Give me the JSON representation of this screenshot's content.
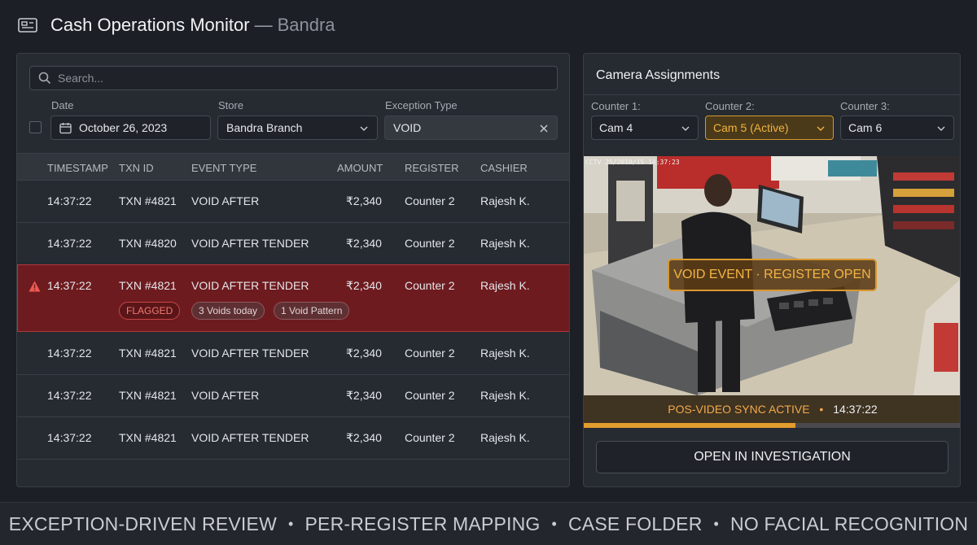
{
  "header": {
    "title": "Cash Operations Monitor",
    "separator": "—",
    "subtitle": "Bandra",
    "icon": "register-icon"
  },
  "search": {
    "placeholder": "Search..."
  },
  "filters": {
    "date_label": "Date",
    "date_value": "October 26, 2023",
    "store_label": "Store",
    "store_value": "Bandra Branch",
    "type_label": "Exception Type",
    "type_value": "VOID"
  },
  "table": {
    "headers": [
      "TIMESTAMP",
      "TXN ID",
      "EVENT TYPE",
      "AMOUNT",
      "REGISTER",
      "CASHIER"
    ],
    "rows": [
      {
        "timestamp": "14:37:22",
        "txn": "TXN #4821",
        "event": "VOID AFTER",
        "amount": "₹2,340",
        "register": "Counter 2",
        "cashier": "Rajesh K."
      },
      {
        "timestamp": "14:37:22",
        "txn": "TXN #4820",
        "event": "VOID AFTER TENDER",
        "amount": "₹2,340",
        "register": "Counter 2",
        "cashier": "Rajesh K."
      },
      {
        "timestamp": "14:37:22",
        "txn": "TXN #4821",
        "event": "VOID AFTER TENDER",
        "amount": "₹2,340",
        "register": "Counter 2",
        "cashier": "Rajesh K.",
        "flag": "FLAGGED",
        "tags": [
          "3 Voids today",
          "1 Void Pattern"
        ]
      },
      {
        "timestamp": "14:37:22",
        "txn": "TXN #4821",
        "event": "VOID AFTER TENDER",
        "amount": "₹2,340",
        "register": "Counter 2",
        "cashier": "Rajesh K."
      },
      {
        "timestamp": "14:37:22",
        "txn": "TXN #4821",
        "event": "VOID AFTER",
        "amount": "₹2,340",
        "register": "Counter 2",
        "cashier": "Rajesh K."
      },
      {
        "timestamp": "14:37:22",
        "txn": "TXN #4821",
        "event": "VOID AFTER TENDER",
        "amount": "₹2,340",
        "register": "Counter 2",
        "cashier": "Rajesh K."
      }
    ]
  },
  "cameras": {
    "title": "Camera Assignments",
    "counters": [
      {
        "label": "Counter 1:",
        "value": "Cam 4"
      },
      {
        "label": "Counter 2:",
        "value": "Cam 5 (Active)"
      },
      {
        "label": "Counter 3:",
        "value": "Cam 6"
      }
    ],
    "cctv_stamp": "CCTV 25/2010/15 14:37:23",
    "banner": "VOID EVENT · REGISTER OPEN",
    "sync_label": "POS-VIDEO SYNC ACTIVE",
    "sync_dot": "•",
    "sync_time": "14:37:22",
    "playback_progress": 0.56,
    "open_button": "OPEN IN INVESTIGATION"
  },
  "footer": {
    "items": [
      "EXCEPTION-DRIVEN REVIEW",
      "PER-REGISTER MAPPING",
      "CASE FOLDER",
      "NO FACIAL RECOGNITION"
    ],
    "dot": "•"
  },
  "colors": {
    "background": "#1c1f25",
    "panel": "#262a31",
    "flag_row": "#6e1b1f",
    "accent_amber": "#e39c2e"
  }
}
